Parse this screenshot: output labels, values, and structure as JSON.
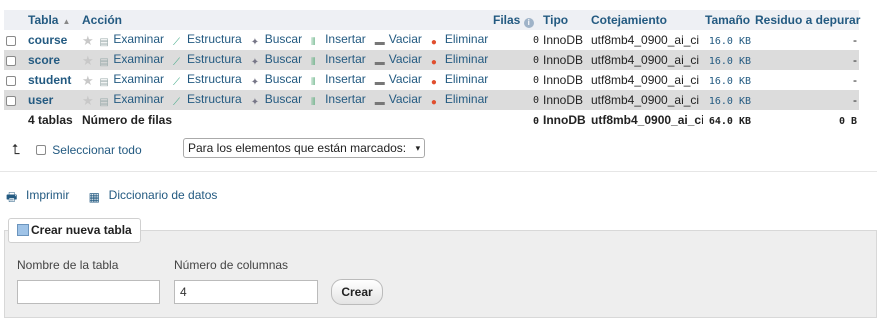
{
  "table": {
    "headers": {
      "table": "Tabla",
      "action": "Acción",
      "rows": "Filas",
      "type": "Tipo",
      "collation": "Cotejamiento",
      "size": "Tamaño",
      "overhead": "Residuo a depurar"
    },
    "actions": {
      "browse": "Examinar",
      "structure": "Estructura",
      "search": "Buscar",
      "insert": "Insertar",
      "empty": "Vaciar",
      "drop": "Eliminar"
    },
    "rows": [
      {
        "name": "course",
        "rows": "0",
        "type": "InnoDB",
        "collation": "utf8mb4_0900_ai_ci",
        "size": "16.0 KB",
        "overhead": "-"
      },
      {
        "name": "score",
        "rows": "0",
        "type": "InnoDB",
        "collation": "utf8mb4_0900_ai_ci",
        "size": "16.0 KB",
        "overhead": "-"
      },
      {
        "name": "student",
        "rows": "0",
        "type": "InnoDB",
        "collation": "utf8mb4_0900_ai_ci",
        "size": "16.0 KB",
        "overhead": "-"
      },
      {
        "name": "user",
        "rows": "0",
        "type": "InnoDB",
        "collation": "utf8mb4_0900_ai_ci",
        "size": "16.0 KB",
        "overhead": "-"
      }
    ],
    "footer": {
      "count": "4 tablas",
      "label": "Número de filas",
      "rows": "0",
      "type": "InnoDB",
      "collation": "utf8mb4_0900_ai_ci",
      "size": "64.0 KB",
      "overhead": "0 B"
    }
  },
  "bulk": {
    "check_all": "Seleccionar todo",
    "with_selected": "Para los elementos que están marcados:"
  },
  "links": {
    "print": "Imprimir",
    "dictionary": "Diccionario de datos"
  },
  "create": {
    "tab": "Crear nueva tabla",
    "name_label": "Nombre de la tabla",
    "name_value": "",
    "cols_label": "Número de columnas",
    "cols_value": "4",
    "button": "Crear"
  },
  "colors": {
    "link": "#235a81",
    "row_alt": "#dcdcdc",
    "header_bg": "#eef0f4",
    "drop": "#e04f2f"
  }
}
